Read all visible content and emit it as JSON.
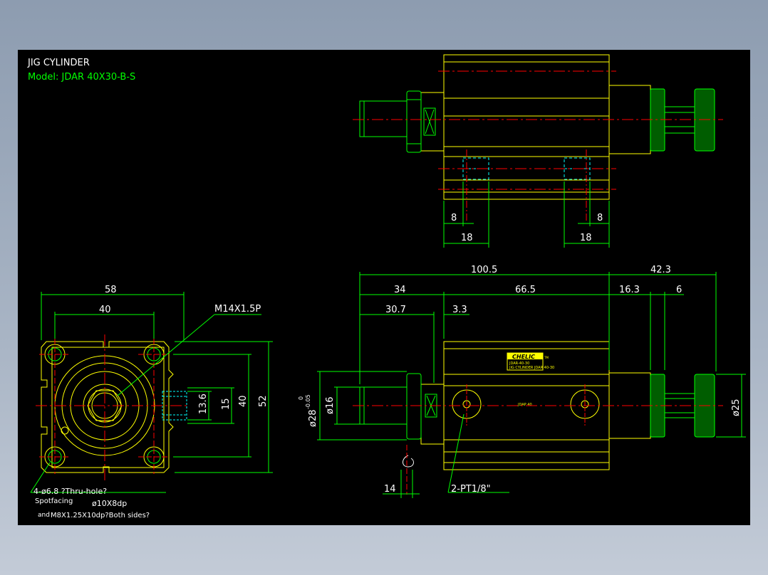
{
  "title": "JIG CYLINDER",
  "model": "Model:  JDAR 40X30-B-S",
  "colors": {
    "background": "#000000",
    "outline": "#ffff00",
    "dimension": "#00ff00",
    "centerline": "#ff0000",
    "hidden": "#00ffff",
    "text": "#ffffff",
    "model_text": "#00ff00",
    "nameplate": "#ffff00",
    "knurl": "#00aa00"
  },
  "top_view": {
    "dims": {
      "left_inner": "8",
      "right_inner": "8",
      "left_outer": "18",
      "right_outer": "18"
    }
  },
  "front_view": {
    "dims": {
      "d58": "58",
      "d40w": "40",
      "d52": "52",
      "d40h": "40",
      "d15": "15",
      "d13_6": "13.6"
    },
    "callout_thread": "M14X1.5P",
    "note_line1": "4-ø6.8 ?Thru-hole?",
    "note_line2a": "Spotfacing",
    "note_line2b": "ø10X8dp",
    "note_line3a": "and",
    "note_line3b": "M8X1.25X10dp?Both sides?"
  },
  "side_view": {
    "dims": {
      "overall": "100.5",
      "ext": "42.3",
      "body": "66.5",
      "rod": "34",
      "s30_7": "30.7",
      "s3_3": "3.3",
      "s16_3": "16.3",
      "s6": "6",
      "s14": "14",
      "dia16": "ø16",
      "dia28": "ø28",
      "tol_up": "0",
      "tol_low": "-0.05",
      "dia25": "ø25"
    },
    "port_callout": "2-PT1/8\"",
    "brand": "CHELIC",
    "brand_tm": "TM",
    "plate_line1": "JDAR-40-30",
    "plate_line2": "JIG CYLINDER JDAR 40-30",
    "body_label": "JDAP 40"
  }
}
